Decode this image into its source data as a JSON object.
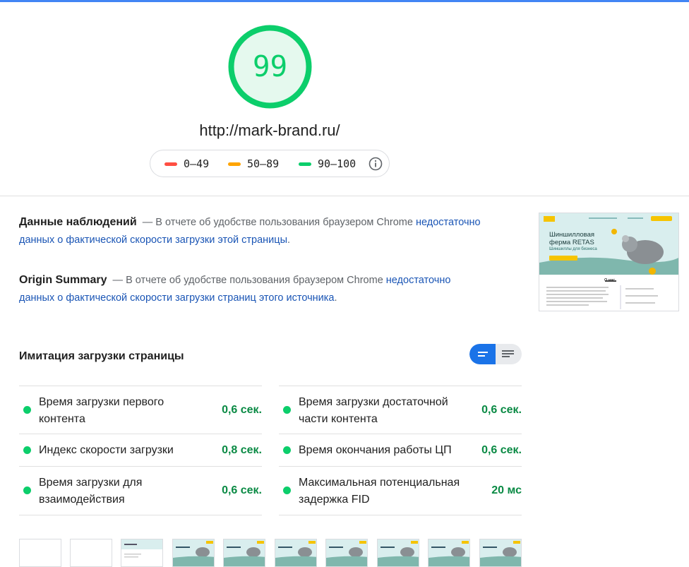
{
  "score": "99",
  "url": "http://mark-brand.ru/",
  "legend": {
    "poor": "0–49",
    "average": "50–89",
    "good": "90–100",
    "colors": {
      "poor": "#ff4e42",
      "average": "#ffa400",
      "good": "#0cce6b"
    }
  },
  "field_data": {
    "title": "Данные наблюдений",
    "dash": "—",
    "text": "В отчете об удобстве пользования браузером Chrome",
    "link": "недостаточно данных о фактической скорости загрузки этой страницы",
    "end": "."
  },
  "origin_summary": {
    "title": "Origin Summary",
    "dash": "—",
    "text": "В отчете об удобстве пользования браузером Chrome",
    "link": "недостаточно данных о фактической скорости загрузки страниц этого источника",
    "end": "."
  },
  "thumbnail": {
    "heading": "Шиншилловая ферма RETAS",
    "subheading": "Шиншиллы для бизнеса",
    "section": "О нас"
  },
  "lab": {
    "title": "Имитация загрузки страницы",
    "metrics": [
      {
        "name": "Время загрузки первого контента",
        "value": "0,6 сек."
      },
      {
        "name": "Время загрузки достаточной части контента",
        "value": "0,6 сек."
      },
      {
        "name": "Индекс скорости загрузки",
        "value": "0,8 сек."
      },
      {
        "name": "Время окончания работы ЦП",
        "value": "0,6 сек."
      },
      {
        "name": "Время загрузки для взаимодействия",
        "value": "0,6 сек."
      },
      {
        "name": "Максимальная потенциальная задержка FID",
        "value": "20 мс"
      }
    ]
  },
  "accent": "#1a73e8"
}
